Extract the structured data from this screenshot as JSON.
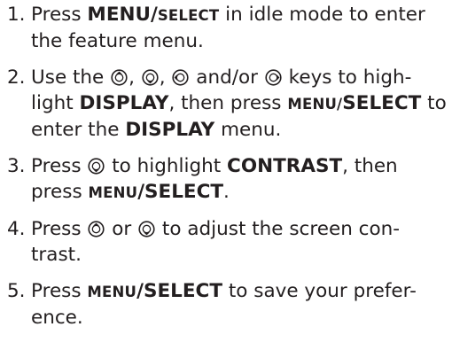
{
  "steps": [
    {
      "num": "1.",
      "t1": "Press ",
      "menu_select_a": "MENU/",
      "menu_select_b": "SELECT",
      "t2": " in idle mode to enter the feature menu."
    },
    {
      "num": "2.",
      "t1": "Use the ",
      "sep1": ", ",
      "sep2": ", ",
      "sep3": " and/or ",
      "t2": " keys to high-light ",
      "display1": "DISPLAY",
      "t3": ", then press ",
      "menu_select_a": "MENU/",
      "menu_select_b": "SELECT",
      "t4": " to enter the ",
      "display2": "DISPLAY",
      "t5": " menu."
    },
    {
      "num": "3.",
      "t1": "Press ",
      "t2": " to highlight ",
      "contrast": "CONTRAST",
      "t3": ", then press ",
      "menu_select_a": "MENU",
      "menu_select_b": "/SELECT",
      "t4": "."
    },
    {
      "num": "4.",
      "t1": "Press ",
      "t2": " or ",
      "t3": " to adjust the screen con-trast."
    },
    {
      "num": "5.",
      "t1": "Press ",
      "menu_select_a": "MENU",
      "menu_select_b": "/SELECT",
      "t2": " to save your prefer-ence."
    }
  ],
  "icons": {
    "up": "up-key-icon",
    "down": "down-key-icon",
    "left": "left-key-icon",
    "right": "right-key-icon"
  },
  "colors": {
    "text": "#231f20"
  }
}
